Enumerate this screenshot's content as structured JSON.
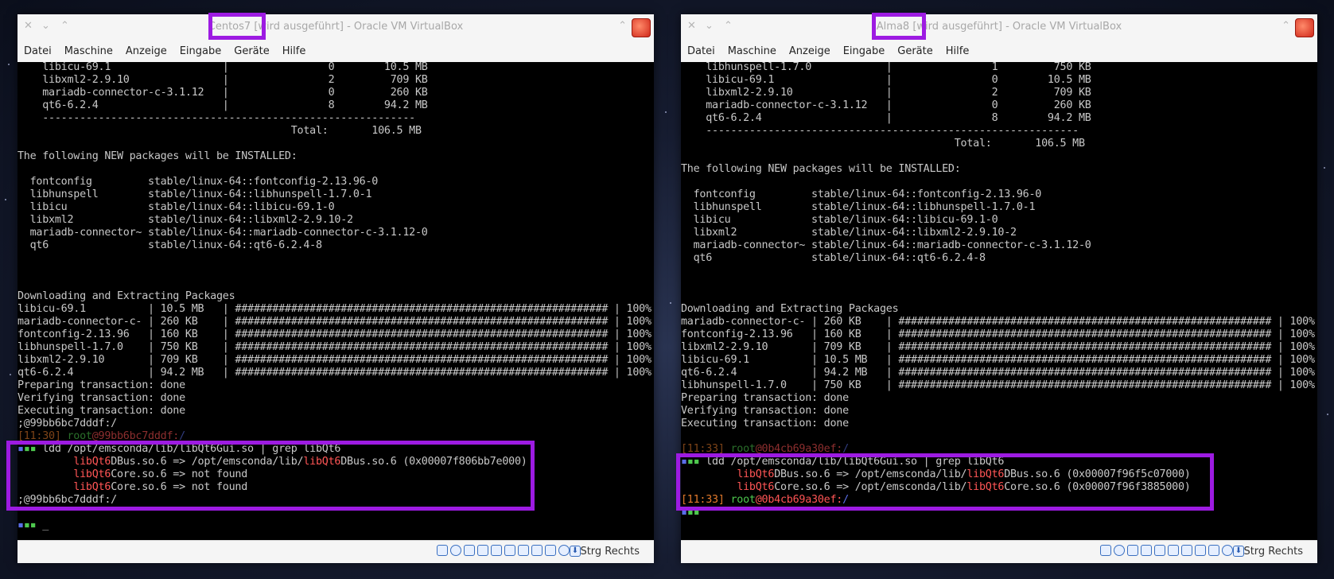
{
  "windows": {
    "left": {
      "title_name": "Centos7",
      "title_rest": " [wird ausgeführt] - Oracle VM VirtualBox",
      "menu": [
        "Datei",
        "Maschine",
        "Anzeige",
        "Eingabe",
        "Geräte",
        "Hilfe"
      ],
      "host_key": "Strg Rechts",
      "terminal": {
        "pkg_rows": [
          "    libicu-69.1                  |                0        10.5 MB",
          "    libxml2-2.9.10               |                2         709 KB",
          "    mariadb-connector-c-3.1.12   |                0         260 KB",
          "    qt6-6.2.4                    |                8        94.2 MB",
          "    ------------------------------------------------------------",
          "                                            Total:       106.5 MB",
          "",
          "The following NEW packages will be INSTALLED:",
          "",
          "  fontconfig         stable/linux-64::fontconfig-2.13.96-0",
          "  libhunspell        stable/linux-64::libhunspell-1.7.0-1",
          "  libicu             stable/linux-64::libicu-69.1-0",
          "  libxml2            stable/linux-64::libxml2-2.9.10-2",
          "  mariadb-connector~ stable/linux-64::mariadb-connector-c-3.1.12-0",
          "  qt6                stable/linux-64::qt6-6.2.4-8",
          "",
          "",
          "",
          "Downloading and Extracting Packages",
          "libicu-69.1          | 10.5 MB   | ############################################################ | 100%",
          "mariadb-connector-c- | 260 KB    | ############################################################ | 100%",
          "fontconfig-2.13.96   | 160 KB    | ############################################################ | 100%",
          "libhunspell-1.7.0    | 750 KB    | ############################################################ | 100%",
          "libxml2-2.9.10       | 709 KB    | ############################################################ | 100%",
          "qt6-6.2.4            | 94.2 MB   | ############################################################ | 100%",
          "Preparing transaction: done",
          "Verifying transaction: done",
          "Executing transaction: done",
          ";@99bb6bc7dddf:/"
        ],
        "prompt_time": "[11:30]",
        "prompt_user": "root",
        "prompt_host": "@99bb6bc7dddf:",
        "prompt_path": "/",
        "command": " ldd /opt/emsconda/lib/libQt6Gui.so | grep libQt6",
        "ldd_lines": [
          {
            "lib": "libQt6",
            "rest1": "DBus.so.6 => /opt/emsconda/lib/",
            "lib2": "libQt6",
            "rest2": "DBus.so.6 (0x00007f806bb7e000)"
          },
          {
            "lib": "libQt6",
            "rest1": "Core.so.6 => not found",
            "lib2": "",
            "rest2": ""
          },
          {
            "lib": "libQt6",
            "rest1": "Core.so.6 => not found",
            "lib2": "",
            "rest2": ""
          }
        ],
        "after": ";@99bb6bc7dddf:/",
        "cursor": "_"
      }
    },
    "right": {
      "title_name": "Alma8",
      "title_rest": " [wird ausgeführt] - Oracle VM VirtualBox",
      "menu": [
        "Datei",
        "Maschine",
        "Anzeige",
        "Eingabe",
        "Geräte",
        "Hilfe"
      ],
      "host_key": "Strg Rechts",
      "terminal": {
        "pkg_rows": [
          "    libhunspell-1.7.0            |                1         750 KB",
          "    libicu-69.1                  |                0        10.5 MB",
          "    libxml2-2.9.10               |                2         709 KB",
          "    mariadb-connector-c-3.1.12   |                0         260 KB",
          "    qt6-6.2.4                    |                8        94.2 MB",
          "    ------------------------------------------------------------",
          "                                            Total:       106.5 MB",
          "",
          "The following NEW packages will be INSTALLED:",
          "",
          "  fontconfig         stable/linux-64::fontconfig-2.13.96-0",
          "  libhunspell        stable/linux-64::libhunspell-1.7.0-1",
          "  libicu             stable/linux-64::libicu-69.1-0",
          "  libxml2            stable/linux-64::libxml2-2.9.10-2",
          "  mariadb-connector~ stable/linux-64::mariadb-connector-c-3.1.12-0",
          "  qt6                stable/linux-64::qt6-6.2.4-8",
          "",
          "",
          "",
          "Downloading and Extracting Packages",
          "mariadb-connector-c- | 260 KB    | ############################################################ | 100%",
          "fontconfig-2.13.96   | 160 KB    | ############################################################ | 100%",
          "libxml2-2.9.10       | 709 KB    | ############################################################ | 100%",
          "libicu-69.1          | 10.5 MB   | ############################################################ | 100%",
          "qt6-6.2.4            | 94.2 MB   | ############################################################ | 100%",
          "libhunspell-1.7.0    | 750 KB    | ############################################################ | 100%",
          "Preparing transaction: done",
          "Verifying transaction: done",
          "Executing transaction: done",
          ""
        ],
        "prompt_time": "[11:33]",
        "prompt_user": "root",
        "prompt_host": "@0b4cb69a30ef:",
        "prompt_path": "/",
        "command": " ldd /opt/emsconda/lib/libQt6Gui.so | grep libQt6",
        "ldd_lines": [
          {
            "lib": "libQt6",
            "rest1": "DBus.so.6 => /opt/emsconda/lib/",
            "lib2": "libQt6",
            "rest2": "DBus.so.6 (0x00007f96f5c07000)"
          },
          {
            "lib": "libQt6",
            "rest1": "Core.so.6 => /opt/emsconda/lib/",
            "lib2": "libQt6",
            "rest2": "Core.so.6 (0x00007f96f3885000)"
          }
        ],
        "after_time": "[11:33]",
        "after_user": "root",
        "after_host": "@0b4cb69a30ef:",
        "after_path": "/",
        "cursor": ""
      }
    }
  },
  "colors": {
    "highlight": "#9d1be2",
    "lib_red": "#ff5555",
    "prompt_green": "#4ec84e",
    "prompt_orange": "#e37a2c"
  }
}
